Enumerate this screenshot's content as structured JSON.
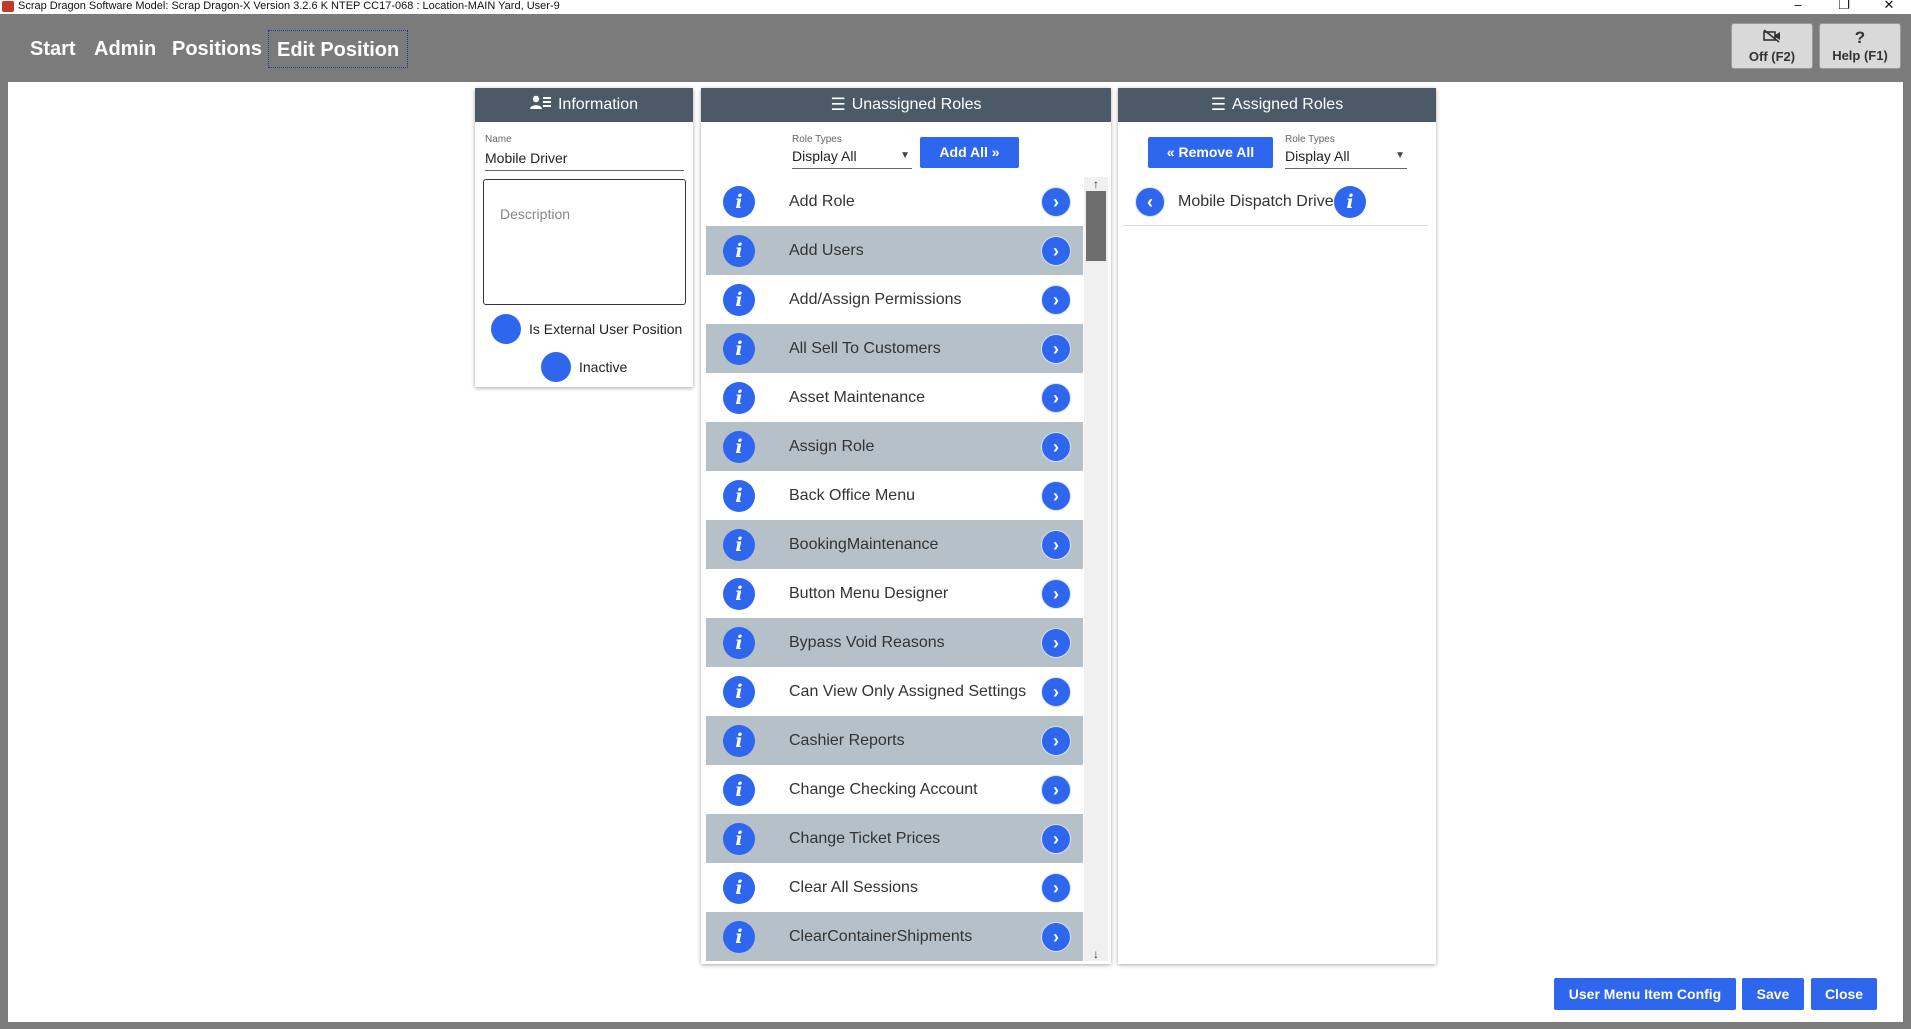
{
  "window": {
    "title": "Scrap Dragon Software Model: Scrap Dragon-X Version 3.2.6 K NTEP CC17-068 : Location-MAIN Yard, User-9",
    "minimize_glyph": "–",
    "restore_glyph": "❐",
    "close_glyph": "✕"
  },
  "nav": {
    "items": [
      "Start",
      "Admin",
      "Positions",
      "Edit Position"
    ],
    "active_index": 3
  },
  "toolbar": {
    "off_label": "Off (F2)",
    "off_icon": "video-off-icon",
    "help_label": "Help (F1)",
    "help_glyph": "?"
  },
  "information": {
    "header": "Information",
    "name_label": "Name",
    "name_value": "Mobile Driver",
    "description_placeholder": "Description",
    "external_label": "Is External User Position",
    "inactive_label": "Inactive"
  },
  "unassigned": {
    "header": "Unassigned Roles",
    "role_types_label": "Role Types",
    "role_types_value": "Display All",
    "add_all_label": "Add All »",
    "roles": [
      "Add Role",
      "Add Users",
      "Add/Assign Permissions",
      "All Sell To Customers",
      "Asset Maintenance",
      "Assign Role",
      "Back Office Menu",
      "BookingMaintenance",
      "Button Menu Designer",
      "Bypass Void Reasons",
      "Can View Only Assigned Settings",
      "Cashier Reports",
      "Change Checking Account",
      "Change Ticket Prices",
      "Clear All Sessions",
      "ClearContainerShipments"
    ],
    "info_glyph": "i",
    "add_glyph": "›",
    "scroll_up": "↑",
    "scroll_down": "↓"
  },
  "assigned": {
    "header": "Assigned Roles",
    "remove_all_label": "« Remove All",
    "role_types_label": "Role Types",
    "role_types_value": "Display All",
    "roles": [
      "Mobile Dispatch Driver"
    ],
    "remove_glyph": "‹",
    "info_glyph": "i"
  },
  "footer": {
    "user_menu_label": "User Menu Item Config",
    "save_label": "Save",
    "close_label": "Close"
  },
  "colors": {
    "accent": "#2f66ee",
    "header": "#4b5a66",
    "alt_row": "#b5c0c8",
    "chrome": "#7b7b7b"
  }
}
